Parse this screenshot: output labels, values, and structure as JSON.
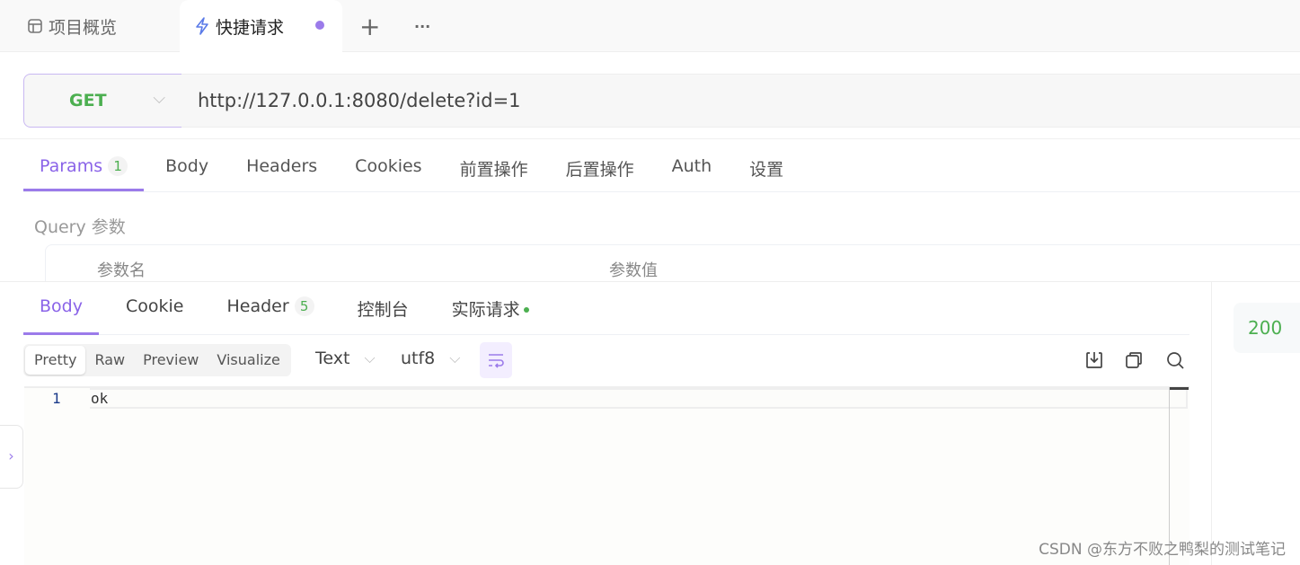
{
  "tabs": [
    {
      "label": "项目概览",
      "icon": "layout-icon"
    },
    {
      "label": "快捷请求",
      "icon": "lightning-icon",
      "unsaved": true
    }
  ],
  "tab_actions": {
    "add": "+",
    "more": "···"
  },
  "request": {
    "method": "GET",
    "url": "http://127.0.0.1:8080/delete?id=1"
  },
  "request_tabs": [
    {
      "label": "Params",
      "badge": "1"
    },
    {
      "label": "Body"
    },
    {
      "label": "Headers"
    },
    {
      "label": "Cookies"
    },
    {
      "label": "前置操作"
    },
    {
      "label": "后置操作"
    },
    {
      "label": "Auth"
    },
    {
      "label": "设置"
    }
  ],
  "query": {
    "title": "Query 参数",
    "columns": [
      "参数名",
      "参数值"
    ]
  },
  "response_tabs": [
    {
      "label": "Body"
    },
    {
      "label": "Cookie"
    },
    {
      "label": "Header",
      "badge": "5"
    },
    {
      "label": "控制台"
    },
    {
      "label": "实际请求"
    }
  ],
  "view_modes": [
    "Pretty",
    "Raw",
    "Preview",
    "Visualize"
  ],
  "format": "Text",
  "encoding": "utf8",
  "body_lines": [
    {
      "num": "1",
      "text": "ok"
    }
  ],
  "status": {
    "code": "200"
  },
  "watermark": "CSDN @东方不败之鸭梨的测试笔记",
  "colors": {
    "accent": "#9b7bea",
    "success": "#4caf50"
  }
}
